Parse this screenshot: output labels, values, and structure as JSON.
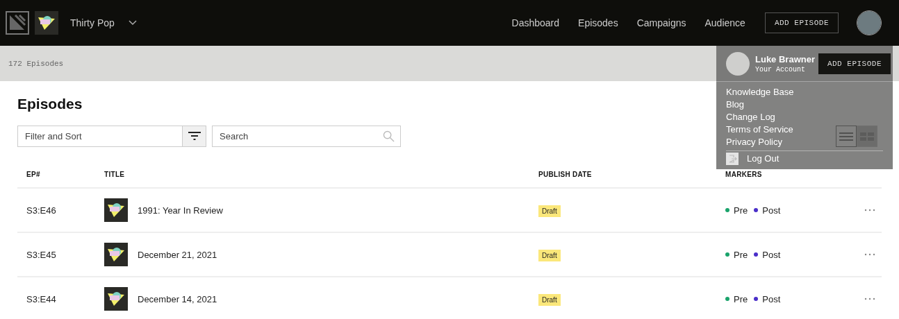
{
  "nav": {
    "show_name": "Thirty Pop",
    "links": [
      "Dashboard",
      "Episodes",
      "Campaigns",
      "Audience"
    ],
    "add_button": "ADD EPISODE"
  },
  "subbar": {
    "count": "172 Episodes",
    "add_button": "ADD EPISODE"
  },
  "account_menu": {
    "name": "Luke Brawner",
    "subtitle": "Your Account",
    "items": [
      "Knowledge Base",
      "Blog",
      "Change Log",
      "Terms of Service",
      "Privacy Policy"
    ],
    "logout": "Log Out"
  },
  "page": {
    "title": "Episodes",
    "filter": {
      "placeholder": "Filter and Sort"
    },
    "search": {
      "placeholder": "Search"
    },
    "view_modes": [
      {
        "kind": "list",
        "selected": true
      },
      {
        "kind": "grid",
        "selected": false
      }
    ]
  },
  "table": {
    "columns": [
      "EP#",
      "TITLE",
      "PUBLISH DATE",
      "MARKERS"
    ],
    "rows": [
      {
        "ep": "S3:E46",
        "title": "1991: Year In Review",
        "status": "Draft",
        "markers": [
          {
            "label": "Pre",
            "color": "#1aa36b"
          },
          {
            "label": "Post",
            "color": "#4a2fc9"
          }
        ]
      },
      {
        "ep": "S3:E45",
        "title": "December 21, 2021",
        "status": "Draft",
        "markers": [
          {
            "label": "Pre",
            "color": "#1aa36b"
          },
          {
            "label": "Post",
            "color": "#4a2fc9"
          }
        ]
      },
      {
        "ep": "S3:E44",
        "title": "December 14, 2021",
        "status": "Draft",
        "markers": [
          {
            "label": "Pre",
            "color": "#1aa36b"
          },
          {
            "label": "Post",
            "color": "#4a2fc9"
          }
        ]
      }
    ]
  }
}
